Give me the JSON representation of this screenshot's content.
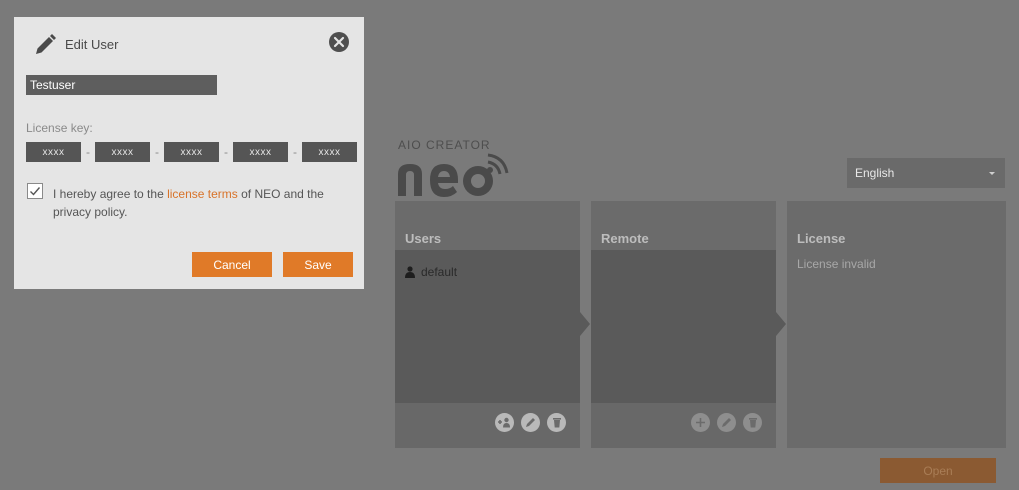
{
  "logo": {
    "subtitle": "AIO CREATOR"
  },
  "language": {
    "selected": "English"
  },
  "panels": {
    "users": {
      "title": "Users",
      "items": [
        "default"
      ]
    },
    "remote": {
      "title": "Remote"
    },
    "license": {
      "title": "License",
      "status": "License invalid"
    }
  },
  "open_button": "Open",
  "dialog": {
    "title": "Edit User",
    "username_value": "Testuser",
    "license_label": "License key:",
    "license_fields": [
      "xxxx",
      "xxxx",
      "xxxx",
      "xxxx",
      "xxxx"
    ],
    "license_separator": "-",
    "agree_before": "I hereby agree to the ",
    "agree_link": "license terms",
    "agree_after": " of NEO and the privacy policy.",
    "agree_checked": true,
    "cancel_label": "Cancel",
    "save_label": "Save"
  },
  "colors": {
    "accent": "#e07a28",
    "background": "#7b7b7b",
    "dialog": "#e5e5e5"
  },
  "icons": [
    "pencil-icon",
    "close-circle-icon",
    "user-icon",
    "add-user-icon",
    "edit-icon",
    "trash-icon",
    "plus-icon",
    "chevron-down-icon",
    "check-icon"
  ]
}
